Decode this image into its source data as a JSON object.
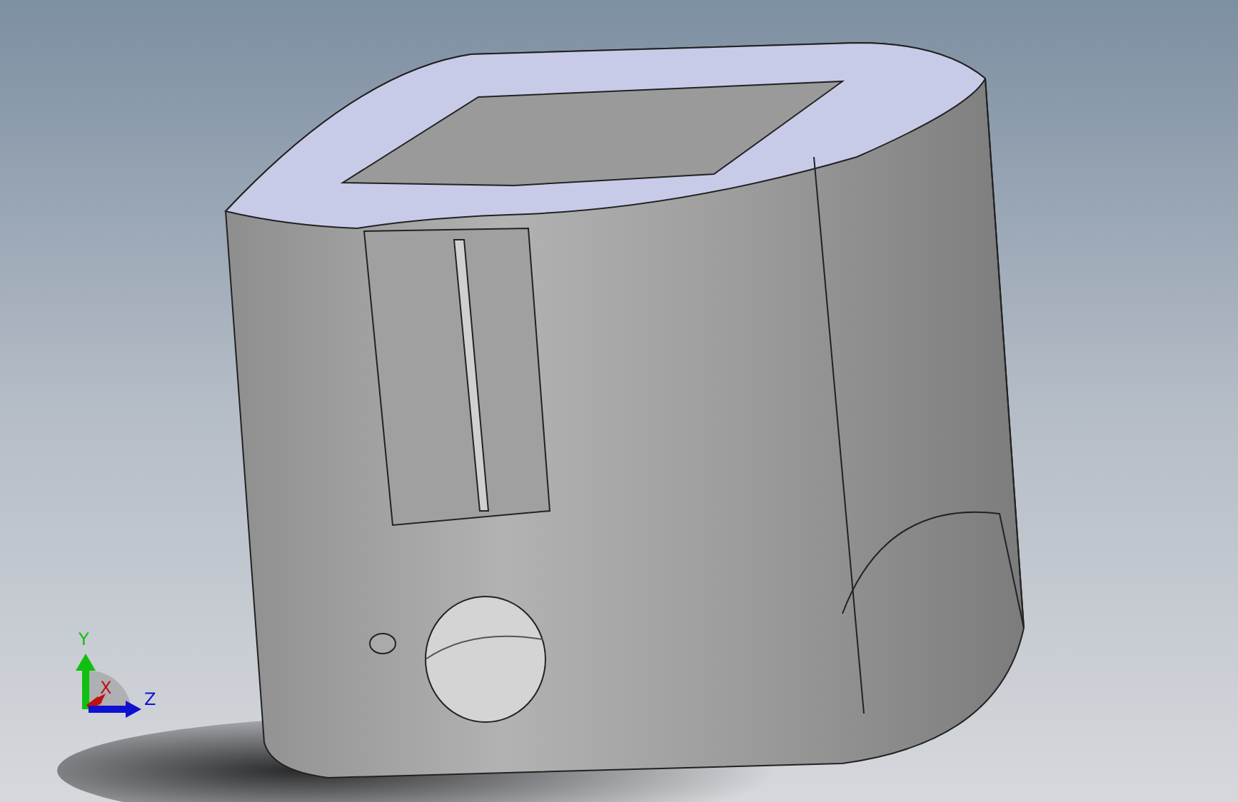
{
  "triad": {
    "axes": [
      {
        "label": "Y",
        "color": "#10c010"
      },
      {
        "label": "X",
        "color": "#c01010"
      },
      {
        "label": "Z",
        "color": "#1010d0"
      }
    ]
  }
}
